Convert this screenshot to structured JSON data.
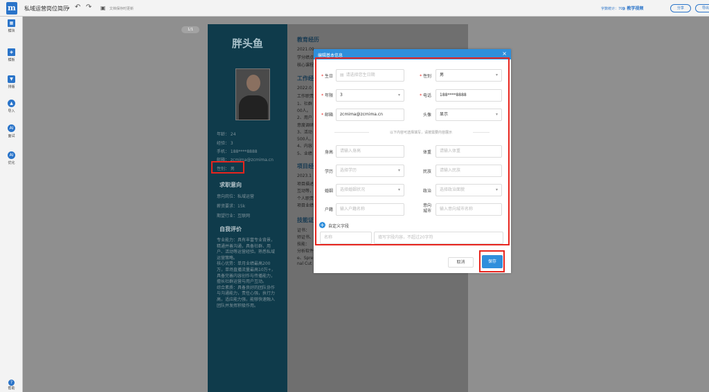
{
  "topbar": {
    "logo": "m",
    "doc_title": "私域运营岗位简历",
    "dropdown": "▾",
    "undo": "↶",
    "redo": "↷",
    "save_icon": "▣",
    "save_hint": "文档保存时更新",
    "word_count": "字数统计：709",
    "tutorial": "◎ 教学视频",
    "share": "分享",
    "download": "导出"
  },
  "sidebar": {
    "items": [
      {
        "label": "模块",
        "icon": "grid-icon"
      },
      {
        "label": "模板",
        "icon": "layers-icon"
      },
      {
        "label": "排版",
        "icon": "shirt-icon"
      },
      {
        "label": "导入",
        "icon": "cloud-upload-icon"
      },
      {
        "label": "面试",
        "icon": "ai-icon"
      },
      {
        "label": "优化",
        "icon": "ai-icon"
      }
    ],
    "help": "帮助"
  },
  "page_badge": "1/1",
  "resume": {
    "name": "胖头鱼",
    "age": "年龄： 24",
    "exp": "经验： 3",
    "phone": "手机： 188****8888",
    "email": "邮箱： zcmima@zcmima.cn",
    "gender": "性别： 男",
    "intent_title": "求职意向",
    "intent_position": "意向岗位：私域运营",
    "intent_salary": "薪资要求：15k",
    "intent_industry": "期望行业：互联网",
    "eval_title": "自我评价",
    "eval_lines": [
      "专业能力：具有丰富专业背景，",
      "精通并善沟通，具备社群、用",
      "户、活动等运营经验。熟悉私域",
      "运营策略。",
      "核心优势：单月业绩最高200",
      "万，单场直播流量最高10万+，",
      "具备完善内容创作与传播能力，",
      "擅长社群运营与用户互动。",
      "综合素质：具备良好的团队协作",
      "与沟通能力，责任心强，执行力",
      "高，适应能力强，能够快速融入",
      "团队并发挥积极作用。"
    ],
    "edu_title": "教育经历",
    "edu_lines": [
      "2021.09",
      "学分绩点",
      "核心课程"
    ],
    "work_title": "工作经",
    "work_lines": [
      "2022.0",
      "工作职责",
      "1、社群",
      "00人。",
      "2、用户",
      "意度调研",
      "3、活动",
      "500人。",
      "4、内容",
      "5、业绩"
    ],
    "proj_title": "项目经",
    "proj_lines": [
      "2023.1",
      "项目描述",
      "互动等，",
      "个人职责",
      "项目业绩"
    ],
    "skill_title": "技能证",
    "skill_lines": [
      "证书：",
      "师证书、",
      "技能：",
      "分析软件",
      "e、Spre",
      "nal Cut"
    ]
  },
  "modal": {
    "title": "编辑基本信息",
    "close": "×",
    "fields": {
      "birthday": {
        "label": "生日",
        "placeholder": "请选择您生日期"
      },
      "gender": {
        "label": "性别",
        "value": "男"
      },
      "exp": {
        "label": "年限",
        "value": "3"
      },
      "phone": {
        "label": "电话",
        "value": "188****8888"
      },
      "email": {
        "label": "邮箱",
        "value": "zcmima@zcmima.cn"
      },
      "avatar": {
        "label": "头像",
        "value": "显示"
      },
      "height": {
        "label": "身高",
        "placeholder": "请输入身高"
      },
      "weight": {
        "label": "体重",
        "placeholder": "请输入体重"
      },
      "education": {
        "label": "学历",
        "placeholder": "选择学历"
      },
      "ethnicity": {
        "label": "民族",
        "placeholder": "请输入民族"
      },
      "marital": {
        "label": "婚姻",
        "placeholder": "选择婚姻状况"
      },
      "political": {
        "label": "政治",
        "placeholder": "选择政治面貌"
      },
      "hukou": {
        "label": "户籍",
        "placeholder": "输入户籍名称"
      },
      "city": {
        "label": "意向\n城市",
        "placeholder": "输入意向城市名称"
      }
    },
    "divider_text": "以下内容可选择填写，请按需要内容展示",
    "custom_label": "自定义字段",
    "custom_name_ph": "名称",
    "custom_content_ph": "填写字段内容，不超过20字符",
    "cancel": "取消",
    "save": "保存"
  }
}
